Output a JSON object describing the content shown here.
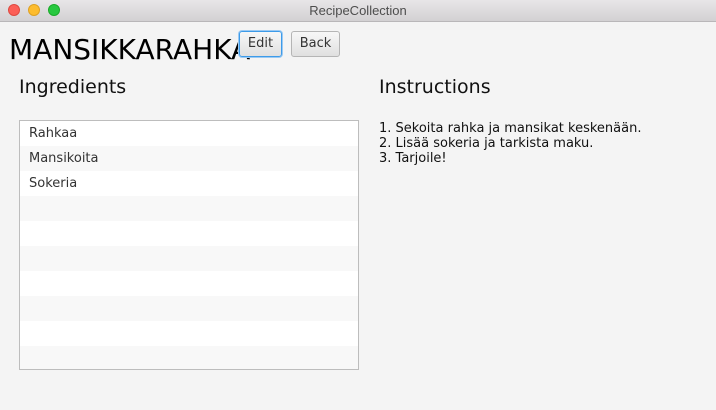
{
  "window": {
    "title": "RecipeCollection"
  },
  "recipe": {
    "name": "MANSIKKARAHKA"
  },
  "toolbar": {
    "edit_label": "Edit",
    "back_label": "Back"
  },
  "ingredients": {
    "heading": "Ingredients",
    "items": [
      "Rahkaa",
      "Mansikoita",
      "Sokeria",
      "",
      "",
      "",
      "",
      "",
      "",
      ""
    ]
  },
  "instructions": {
    "heading": "Instructions",
    "lines": [
      "1. Sekoita rahka ja mansikat keskenään.",
      "2. Lisää sokeria ja tarkista maku.",
      "3. Tarjoile!"
    ]
  },
  "colors": {
    "close": "#fc5f57",
    "minimize": "#fdbc2e",
    "maximize": "#28c840",
    "focus_ring": "#3d9be9"
  }
}
